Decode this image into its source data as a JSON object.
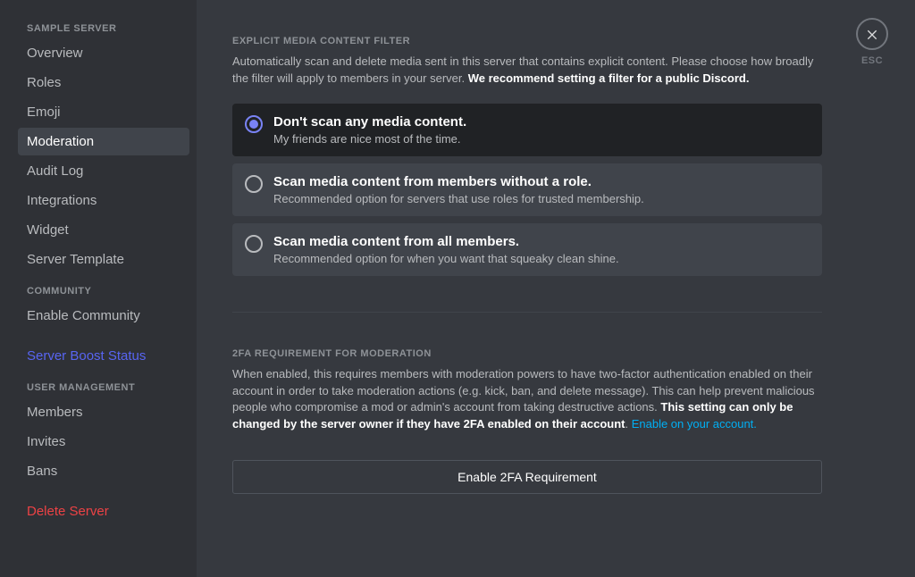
{
  "sidebar": {
    "serverName": "SAMPLE SERVER",
    "items1": [
      {
        "label": "Overview"
      },
      {
        "label": "Roles"
      },
      {
        "label": "Emoji"
      },
      {
        "label": "Moderation"
      },
      {
        "label": "Audit Log"
      },
      {
        "label": "Integrations"
      },
      {
        "label": "Widget"
      },
      {
        "label": "Server Template"
      }
    ],
    "header2": "COMMUNITY",
    "items2": [
      {
        "label": "Enable Community"
      }
    ],
    "boost": "Server Boost Status",
    "header3": "USER MANAGEMENT",
    "items3": [
      {
        "label": "Members"
      },
      {
        "label": "Invites"
      },
      {
        "label": "Bans"
      }
    ],
    "delete": "Delete Server"
  },
  "close": {
    "label": "ESC"
  },
  "filter": {
    "heading": "EXPLICIT MEDIA CONTENT FILTER",
    "desc1": "Automatically scan and delete media sent in this server that contains explicit content. Please choose how broadly the filter will apply to members in your server. ",
    "desc2": "We recommend setting a filter for a public Discord.",
    "options": [
      {
        "title": "Don't scan any media content.",
        "subtitle": "My friends are nice most of the time."
      },
      {
        "title": "Scan media content from members without a role.",
        "subtitle": "Recommended option for servers that use roles for trusted membership."
      },
      {
        "title": "Scan media content from all members.",
        "subtitle": "Recommended option for when you want that squeaky clean shine."
      }
    ]
  },
  "twofa": {
    "heading": "2FA REQUIREMENT FOR MODERATION",
    "desc1": "When enabled, this requires members with moderation powers to have two-factor authentication enabled on their account in order to take moderation actions (e.g. kick, ban, and delete message). This can help prevent malicious people who compromise a mod or admin's account from taking destructive actions. ",
    "desc2": "This setting can only be changed by the server owner if they have 2FA enabled on their account",
    "linkText": "Enable on your account.",
    "button": "Enable 2FA Requirement"
  }
}
